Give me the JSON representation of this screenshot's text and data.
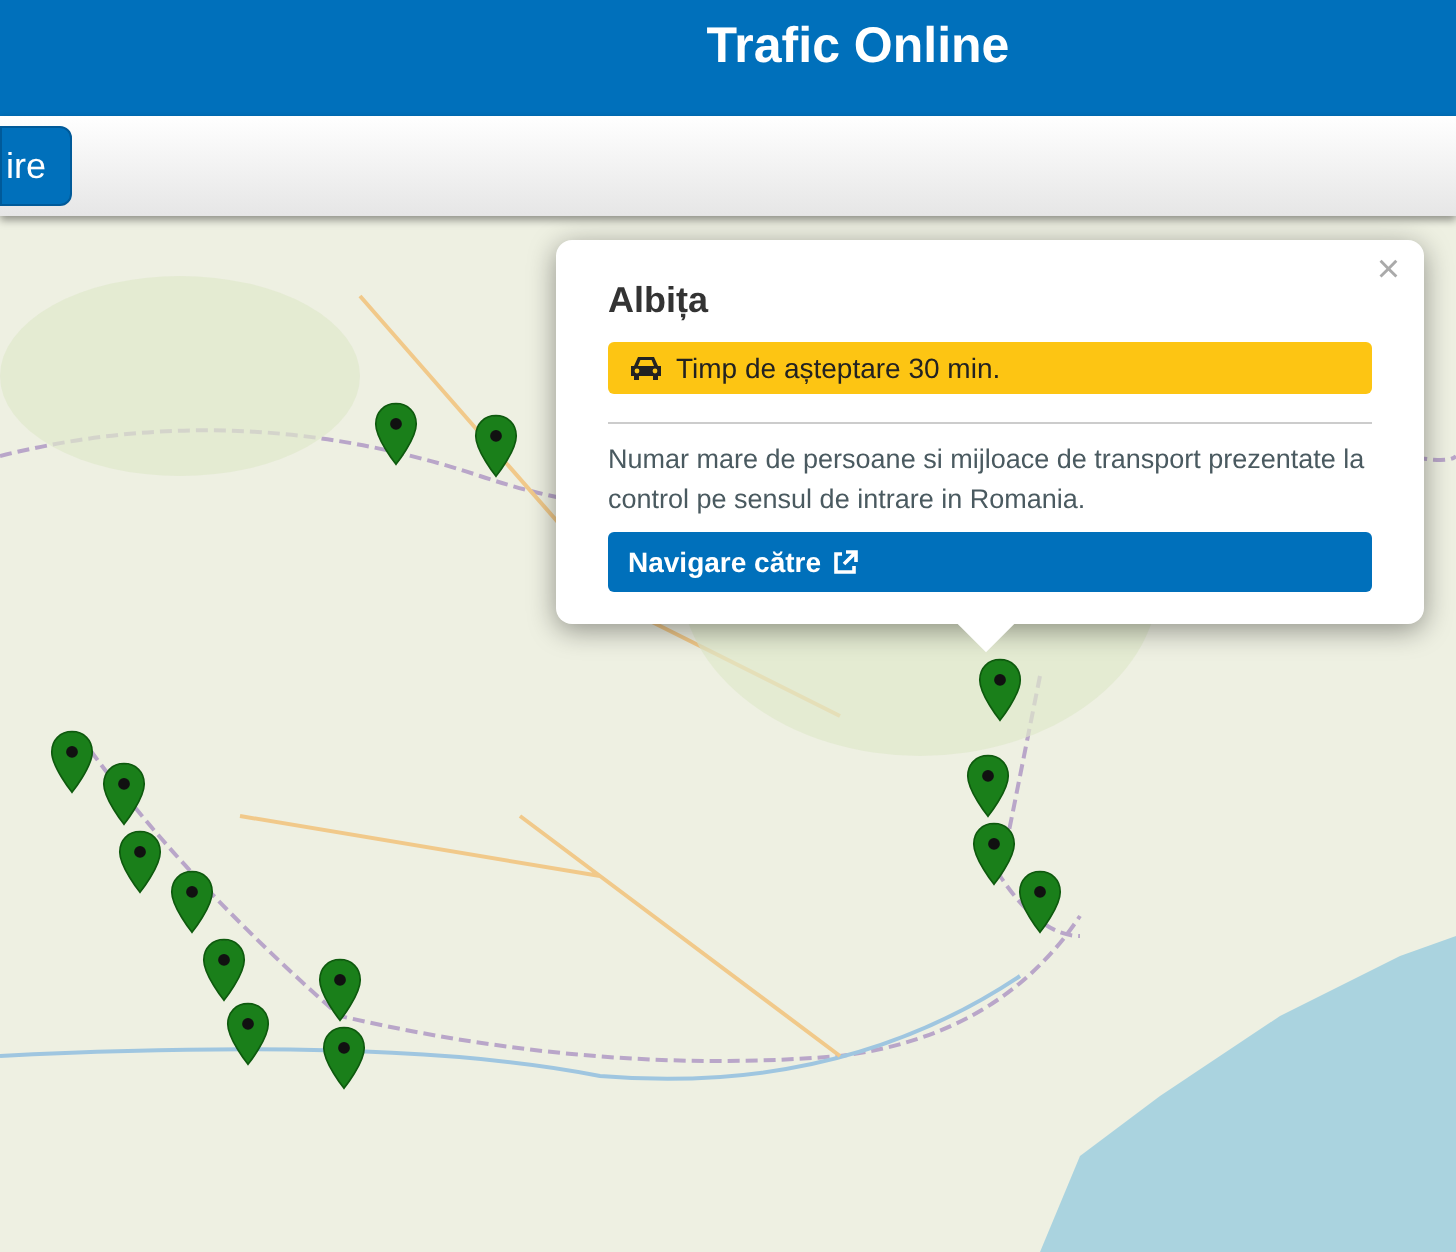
{
  "header": {
    "title": "Trafic Online"
  },
  "toolbar": {
    "button": "ire"
  },
  "popup": {
    "close": "×",
    "title": "Albița",
    "wait_badge": "Timp de așteptare 30 min.",
    "description": "Numar mare de persoane si mijloace de transport prezentate la control pe sensul de intrare in Romania.",
    "navigate_button": "Navigare către"
  }
}
